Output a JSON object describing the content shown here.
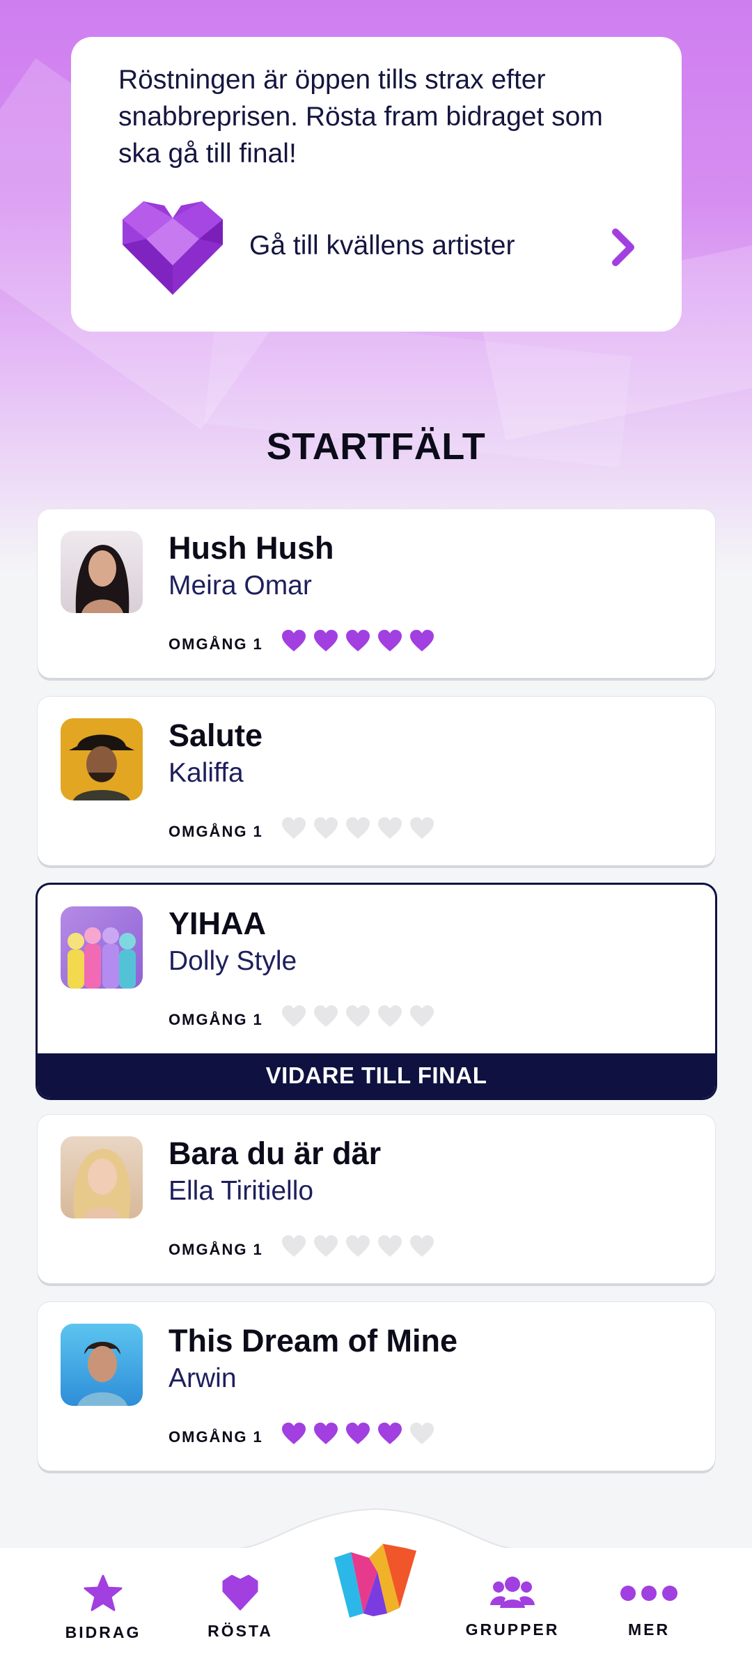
{
  "info": {
    "text": "Röstningen är öppen tills strax efter snabbreprisen. Rösta fram bidraget som ska gå till final!",
    "link_label": "Gå till kvällens artister"
  },
  "section_title": "STARTFÄLT",
  "entries": [
    {
      "song": "Hush Hush",
      "artist": "Meira Omar",
      "round": "OMGÅNG 1",
      "hearts_filled": 5,
      "hearts_total": 5,
      "badge": ""
    },
    {
      "song": "Salute",
      "artist": "Kaliffa",
      "round": "OMGÅNG 1",
      "hearts_filled": 0,
      "hearts_total": 5,
      "badge": ""
    },
    {
      "song": "YIHAA",
      "artist": "Dolly Style",
      "round": "OMGÅNG 1",
      "hearts_filled": 0,
      "hearts_total": 5,
      "badge": "VIDARE TILL FINAL"
    },
    {
      "song": "Bara du är där",
      "artist": "Ella Tiritiello",
      "round": "OMGÅNG 1",
      "hearts_filled": 0,
      "hearts_total": 5,
      "badge": ""
    },
    {
      "song": "This Dream of Mine",
      "artist": "Arwin",
      "round": "OMGÅNG 1",
      "hearts_filled": 4,
      "hearts_total": 5,
      "badge": ""
    }
  ],
  "nav": {
    "bidrag": "BIDRAG",
    "rosta": "RÖSTA",
    "grupper": "GRUPPER",
    "mer": "MER"
  },
  "colors": {
    "accent": "#a23fe0",
    "heart_empty": "#e6e6e8",
    "navy": "#0f1240"
  }
}
